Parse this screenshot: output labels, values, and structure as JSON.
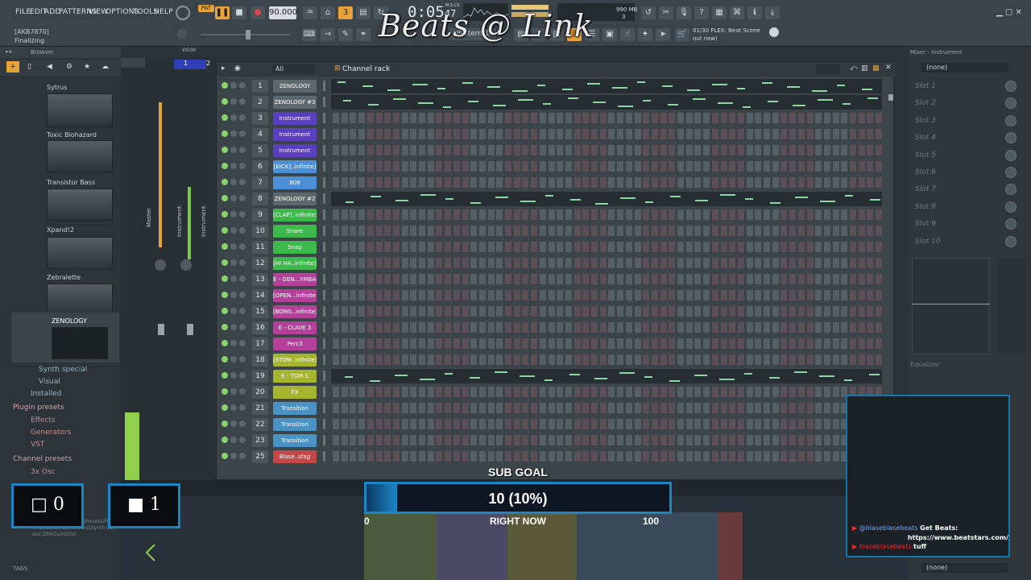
{
  "menu": [
    "FILE",
    "EDIT",
    "ADD",
    "PATTERNS",
    "VIEW",
    "OPTIONS",
    "TOOLS",
    "HELP"
  ],
  "transport": {
    "pat_label": "PAT",
    "tempo": "90.000",
    "time": "0:05",
    "time_sub": "47",
    "time_unit": "M:S:CS"
  },
  "hint": {
    "device": "[AKB7870]",
    "status": "Finalizing"
  },
  "pattern": {
    "label": "Pattern 1"
  },
  "cpu": {
    "mem": "990 MB",
    "voices": "3"
  },
  "news": {
    "line1": "01/30  FLEX: Beat Scene",
    "line2": "out now!"
  },
  "watermark": "Beats @ Link",
  "browser": {
    "title": "Browser",
    "plugins": [
      "Sytrus",
      "Toxic Biohazard",
      "Transistor Bass",
      "Xpand!2",
      "Zebralette",
      "ZENOLOGY"
    ],
    "tree": [
      "Synth special",
      "Visual",
      "Installed"
    ],
    "plugin_presets": "Plugin presets",
    "preset_items": [
      "Effects",
      "Generators",
      "VST"
    ],
    "channel_presets": "Channel presets",
    "channel_item": "3x Osc",
    "path": "image-Line\\FL Studio\\Presets\\Plugin database\\Generators\\Synth classic\\ZENOLOGY.fst",
    "tags": "TAGS"
  },
  "mixer_left": {
    "wide": "Wide",
    "labels": [
      "Master",
      "Instrument",
      "Instrument"
    ],
    "nums": [
      "1",
      "2"
    ]
  },
  "rack": {
    "title": "Channel rack",
    "filter": "All",
    "channels": [
      {
        "n": "1",
        "name": "ZENOLOGY",
        "color": "#5d686e",
        "type": "roll"
      },
      {
        "n": "2",
        "name": "ZENOLOGY #3",
        "color": "#5d686e",
        "type": "roll"
      },
      {
        "n": "3",
        "name": "Instrument",
        "color": "#5a3fc0",
        "type": "steps"
      },
      {
        "n": "4",
        "name": "Instrument",
        "color": "#5a3fc0",
        "type": "steps"
      },
      {
        "n": "5",
        "name": "Instrument",
        "color": "#5a3fc0",
        "type": "steps"
      },
      {
        "n": "6",
        "name": "[KICK]..infinite]",
        "color": "#4d8fd6",
        "type": "steps"
      },
      {
        "n": "7",
        "name": "808",
        "color": "#4d8fd6",
        "type": "steps"
      },
      {
        "n": "8",
        "name": "ZENOLOGY #2",
        "color": "#5d686e",
        "type": "roll"
      },
      {
        "n": "9",
        "name": "[CLAP]..infinite]",
        "color": "#3db84a",
        "type": "steps"
      },
      {
        "n": "10",
        "name": "Snare",
        "color": "#3db84a",
        "type": "steps"
      },
      {
        "n": "11",
        "name": "Snap",
        "color": "#3db84a",
        "type": "steps"
      },
      {
        "n": "12",
        "name": "[HI HA..infinite]",
        "color": "#3db84a",
        "type": "steps"
      },
      {
        "n": "13",
        "name": "E - GEN...YMBAL",
        "color": "#b5409a",
        "type": "steps"
      },
      {
        "n": "14",
        "name": "[OPEN...infinite]",
        "color": "#b5409a",
        "type": "steps"
      },
      {
        "n": "15",
        "name": "[BONG..infinite]",
        "color": "#b5409a",
        "type": "steps"
      },
      {
        "n": "16",
        "name": "E - CLAVE 3",
        "color": "#b5409a",
        "type": "steps"
      },
      {
        "n": "17",
        "name": "Perc3",
        "color": "#b5409a",
        "type": "steps"
      },
      {
        "n": "18",
        "name": "[STOM..infinite]",
        "color": "#a6b52e",
        "type": "steps"
      },
      {
        "n": "19",
        "name": "E - TOM 1",
        "color": "#a6b52e",
        "type": "roll"
      },
      {
        "n": "20",
        "name": "FX",
        "color": "#a6b52e",
        "type": "steps"
      },
      {
        "n": "21",
        "name": "Transition",
        "color": "#4a92c4",
        "type": "steps"
      },
      {
        "n": "22",
        "name": "Transition",
        "color": "#4a92c4",
        "type": "steps"
      },
      {
        "n": "23",
        "name": "Transition",
        "color": "#4a92c4",
        "type": "steps"
      },
      {
        "n": "25",
        "name": "Blase..sfag",
        "color": "#c24848",
        "type": "steps"
      }
    ]
  },
  "mixer_right": {
    "title": "Mixer - Instrument",
    "none": "(none)",
    "slots": [
      "Slot 1",
      "Slot 2",
      "Slot 3",
      "Slot 4",
      "Slot 5",
      "Slot 6",
      "Slot 7",
      "Slot 8",
      "Slot 9",
      "Slot 10"
    ],
    "eq": "Equalizer",
    "none2": "(none)"
  },
  "counters": {
    "left": "0",
    "right": "1"
  },
  "subgoal": {
    "title": "SUB GOAL",
    "value": "10 (10%)",
    "left": "0",
    "right": "100",
    "caption": "RIGHT NOW"
  },
  "chat": {
    "user1": "@blaseblasebeats",
    "msg1": "Get Beats:",
    "link": "https://www.beatstars.com/",
    "user2": "blaseblasebeats",
    "msg2": "tuff"
  },
  "colors": {
    "accent": "#e8a23a",
    "goal": "#1a86c4"
  }
}
